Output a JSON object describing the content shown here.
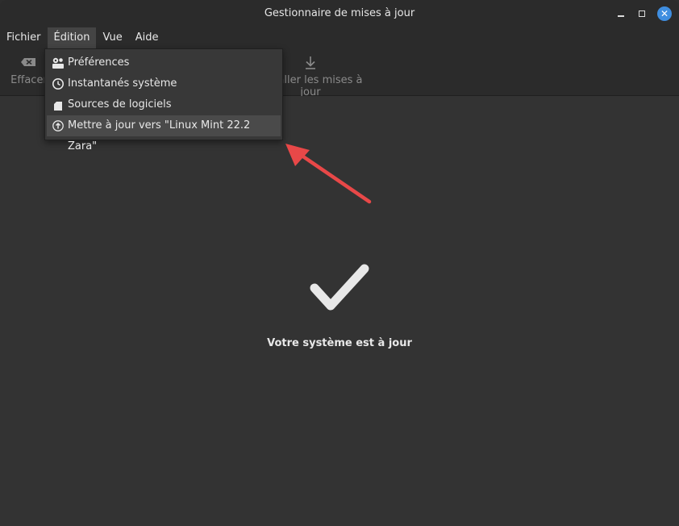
{
  "window": {
    "title": "Gestionnaire de mises à jour"
  },
  "menubar": {
    "items": [
      {
        "label": "Fichier"
      },
      {
        "label": "Édition"
      },
      {
        "label": "Vue"
      },
      {
        "label": "Aide"
      }
    ]
  },
  "toolbar": {
    "clear_label": "Effacer",
    "install_label": "Installer les mises à jour"
  },
  "edit_menu": {
    "items": [
      {
        "label": "Préférences",
        "icon": "preferences-icon"
      },
      {
        "label": "Instantanés système",
        "icon": "clock-icon"
      },
      {
        "label": "Sources de logiciels",
        "icon": "package-icon"
      },
      {
        "label": "Mettre à jour vers \"Linux Mint 22.2 Zara\"",
        "icon": "upgrade-arrow-icon"
      }
    ]
  },
  "status": {
    "message": "Votre système est à jour"
  },
  "colors": {
    "accent": "#3f8ee0",
    "annotation_arrow": "#e84848"
  }
}
